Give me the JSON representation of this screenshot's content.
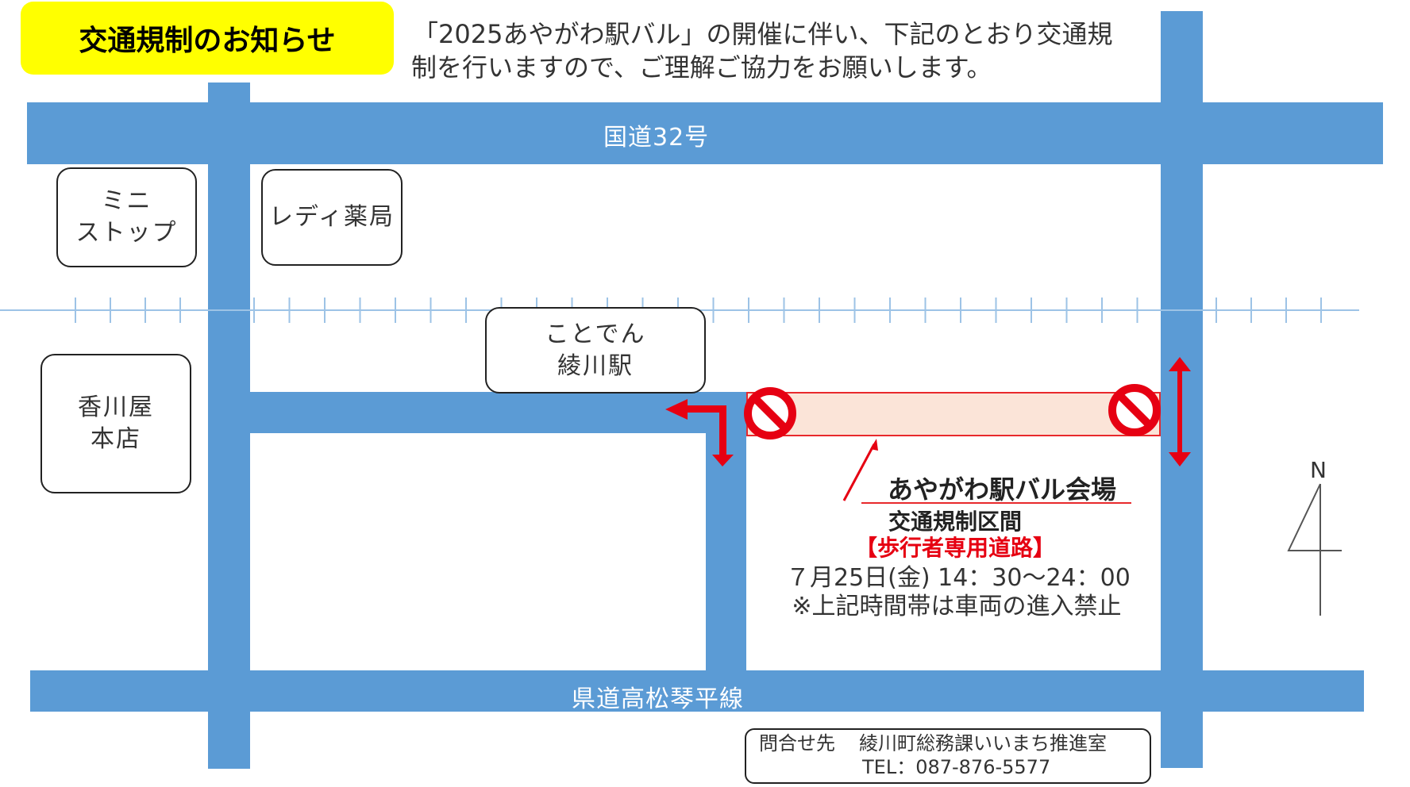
{
  "header": {
    "title": "交通規制のお知らせ",
    "notice_line1": "「2025あやがわ駅バル」の開催に伴い、下記のとおり交通規",
    "notice_line2": "制を行いますので、ご理解ご協力をお願いします。"
  },
  "roads": {
    "national_route": "国道32号",
    "prefectural_road": "県道高松琴平線"
  },
  "landmarks": {
    "ministop": [
      "ミニ",
      "ストップ"
    ],
    "drugstore": "レディ薬局",
    "station": [
      "ことでん",
      "綾川駅"
    ],
    "kagawaya": [
      "香川屋",
      "本店"
    ]
  },
  "restriction": {
    "venue_title": "あやがわ駅バル会場",
    "section_label": "交通規制区間",
    "pedestrian_label": "【歩行者専用道路】",
    "date_time": "７月25日(金) 14：30～24：00",
    "note": "※上記時間帯は車両の進入禁止"
  },
  "contact": {
    "label": "問合せ先",
    "organization": "綾川町総務課いいまち推進室",
    "tel": "TEL：087-876-5577"
  },
  "compass": {
    "north": "N"
  },
  "icons": [
    "no-entry-icon",
    "detour-arrow-icon",
    "two-way-arrow-icon",
    "north-arrow-icon",
    "pointer-line-icon"
  ],
  "colors": {
    "road": "#5b9bd5",
    "title_badge": "#ffff00",
    "restricted_fill": "#fbe4d8",
    "restriction_red": "#e60012",
    "railway": "#9dc3e6"
  }
}
